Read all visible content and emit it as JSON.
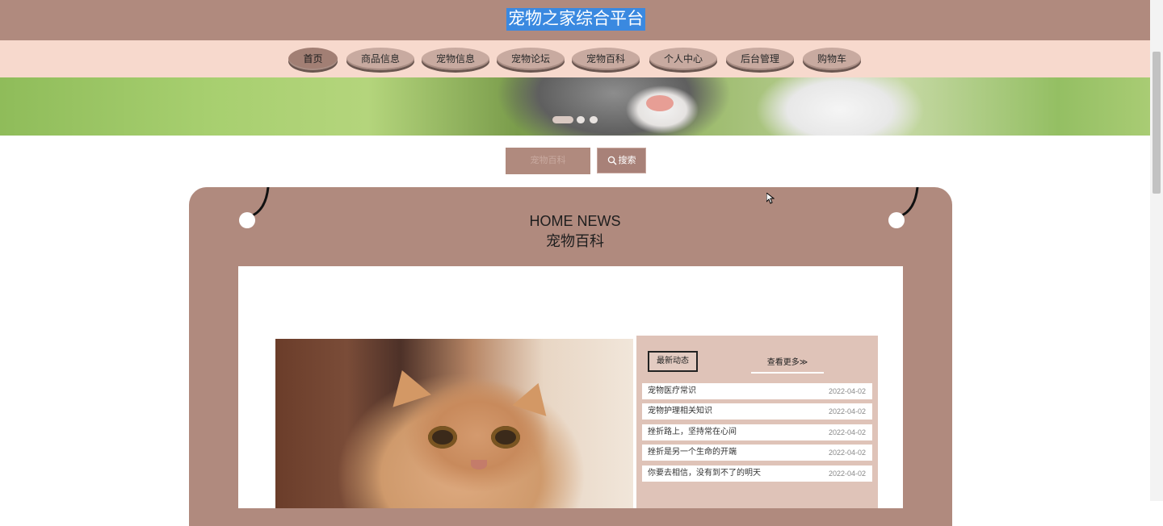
{
  "header": {
    "title": "宠物之家综合平台"
  },
  "nav": {
    "items": [
      {
        "label": "首页",
        "active": true
      },
      {
        "label": "商品信息"
      },
      {
        "label": "宠物信息"
      },
      {
        "label": "宠物论坛"
      },
      {
        "label": "宠物百科"
      },
      {
        "label": "个人中心"
      },
      {
        "label": "后台管理"
      },
      {
        "label": "购物车"
      }
    ]
  },
  "search": {
    "placeholder": "宠物百科",
    "button_label": "搜索",
    "button_icon": "search-icon"
  },
  "section": {
    "title_en": "HOME NEWS",
    "title_cn": "宠物百科"
  },
  "news": {
    "tag": "最新动态",
    "more": "查看更多≫",
    "items": [
      {
        "title": "宠物医疗常识",
        "date": "2022-04-02"
      },
      {
        "title": "宠物护理相关知识",
        "date": "2022-04-02"
      },
      {
        "title": "挫折路上，坚持常在心间",
        "date": "2022-04-02"
      },
      {
        "title": "挫折是另一个生命的开端",
        "date": "2022-04-02"
      },
      {
        "title": "你要去相信，没有到不了的明天",
        "date": "2022-04-02"
      }
    ]
  },
  "colors": {
    "brand": "#b08a7e",
    "nav_bg": "#f7d9cd",
    "news_box": "#dfc3b8",
    "title_highlight": "#3a89e0"
  }
}
